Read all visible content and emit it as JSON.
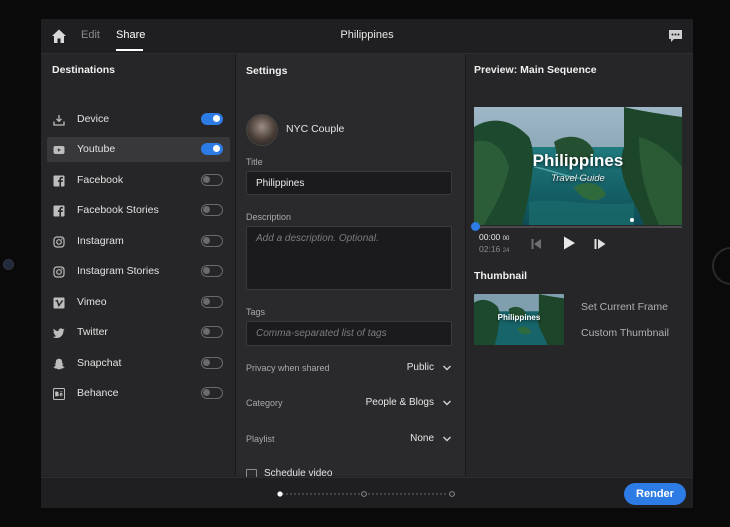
{
  "header": {
    "tabs": [
      {
        "label": "Edit",
        "active": false
      },
      {
        "label": "Share",
        "active": true
      }
    ],
    "title": "Philippines",
    "icons": {
      "home": "home-icon",
      "feedback": "chat-feedback-icon"
    }
  },
  "destinations": {
    "title": "Destinations",
    "items": [
      {
        "label": "Device",
        "icon": "download-icon",
        "enabled": true,
        "selected": false
      },
      {
        "label": "Youtube",
        "icon": "youtube-icon",
        "enabled": true,
        "selected": true
      },
      {
        "label": "Facebook",
        "icon": "facebook-icon",
        "enabled": false,
        "selected": false
      },
      {
        "label": "Facebook Stories",
        "icon": "facebook-icon",
        "enabled": false,
        "selected": false
      },
      {
        "label": "Instagram",
        "icon": "instagram-icon",
        "enabled": false,
        "selected": false
      },
      {
        "label": "Instagram Stories",
        "icon": "instagram-icon",
        "enabled": false,
        "selected": false
      },
      {
        "label": "Vimeo",
        "icon": "vimeo-icon",
        "enabled": false,
        "selected": false
      },
      {
        "label": "Twitter",
        "icon": "twitter-icon",
        "enabled": false,
        "selected": false
      },
      {
        "label": "Snapchat",
        "icon": "snapchat-icon",
        "enabled": false,
        "selected": false
      },
      {
        "label": "Behance",
        "icon": "behance-icon",
        "enabled": false,
        "selected": false
      }
    ]
  },
  "settings": {
    "title": "Settings",
    "account": "NYC Couple",
    "title_label": "Title",
    "title_value": "Philippines",
    "description_label": "Description",
    "description_placeholder": "Add a description. Optional.",
    "tags_label": "Tags",
    "tags_placeholder": "Comma-separated list of tags",
    "privacy_label": "Privacy when shared",
    "privacy_value": "Public",
    "category_label": "Category",
    "category_value": "People & Blogs",
    "playlist_label": "Playlist",
    "playlist_value": "None",
    "schedule_label": "Schedule video",
    "schedule_checked": false
  },
  "preview": {
    "title": "Preview: Main Sequence",
    "overlay_title": "Philippines",
    "overlay_subtitle": "Travel Guide",
    "current_time": "00:00",
    "current_frames": "00",
    "duration": "02:16",
    "duration_frames": "24",
    "playhead_fraction": 0.0
  },
  "thumbnail": {
    "title": "Thumbnail",
    "overlay_title": "Philippines",
    "set_current_frame": "Set Current Frame",
    "custom_thumbnail": "Custom Thumbnail"
  },
  "footer": {
    "render_label": "Render",
    "page_count": 3,
    "active_page": 0
  },
  "colors": {
    "accent": "#2d7be5",
    "panel": "#262628",
    "panel_mid": "#2a2a2c",
    "bar": "#1f1f21"
  }
}
